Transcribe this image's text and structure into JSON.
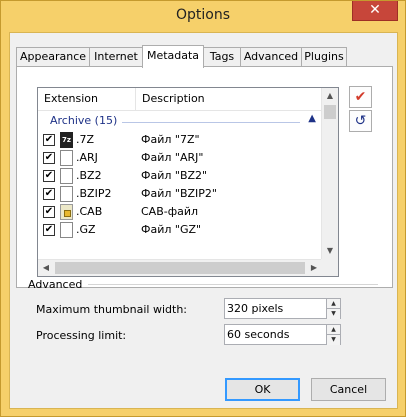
{
  "window": {
    "title": "Options",
    "close_label": "✕"
  },
  "tabs": [
    "Appearance",
    "Internet",
    "Metadata",
    "Tags",
    "Advanced",
    "Plugins"
  ],
  "list": {
    "columns": [
      "Extension",
      "Description"
    ],
    "group": "Archive (15)",
    "rows": [
      {
        "ext": ".7Z",
        "desc": "Файл \"7Z\"",
        "icon": "7z-archive-icon",
        "checked": true
      },
      {
        "ext": ".ARJ",
        "desc": "Файл \"ARJ\"",
        "icon": "file-icon",
        "checked": true
      },
      {
        "ext": ".BZ2",
        "desc": "Файл \"BZ2\"",
        "icon": "file-icon",
        "checked": true
      },
      {
        "ext": ".BZIP2",
        "desc": "Файл \"BZIP2\"",
        "icon": "file-icon",
        "checked": true
      },
      {
        "ext": ".CAB",
        "desc": "CAB-файл",
        "icon": "cab-archive-icon",
        "checked": true
      },
      {
        "ext": ".GZ",
        "desc": "Файл \"GZ\"",
        "icon": "file-icon",
        "checked": true
      }
    ]
  },
  "advanced": {
    "title": "Advanced",
    "thumb_label": "Maximum thumbnail width:",
    "thumb_value": "320 pixels",
    "limit_label": "Processing limit:",
    "limit_value": "60 seconds"
  },
  "buttons": {
    "ok": "OK",
    "cancel": "Cancel"
  },
  "colors": {
    "accent": "#1e3287",
    "title_bar": "#f6d06a",
    "check_red": "#d23a2a"
  }
}
